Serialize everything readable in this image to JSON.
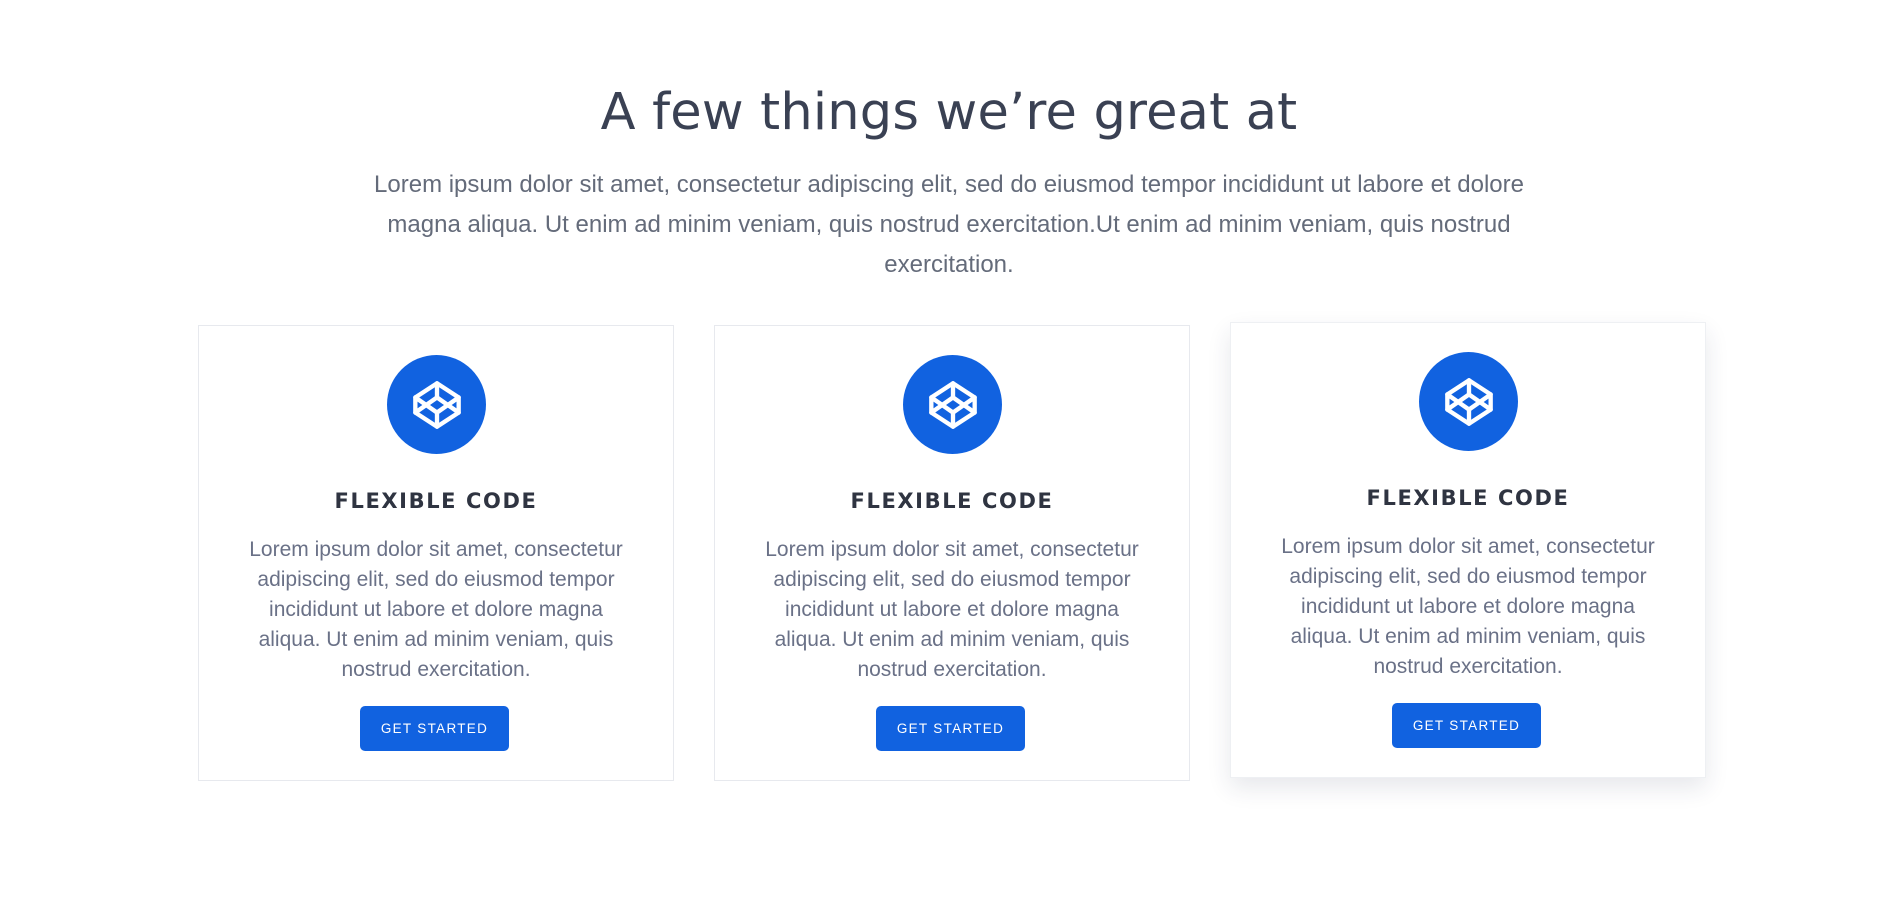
{
  "section": {
    "title": "A few things we’re great at",
    "description": "Lorem ipsum dolor sit amet, consectetur adipiscing elit, sed do eiusmod tempor incididunt ut labore et dolore magna aliqua. Ut enim ad minim veniam, quis nostrud exercitation.Ut enim ad minim veniam, quis nostrud exercitation."
  },
  "cards": [
    {
      "icon": "codepen-cube-icon",
      "title": "FLEXIBLE CODE",
      "text": "Lorem ipsum dolor sit amet, consectetur adipiscing elit, sed do eiusmod tempor incididunt ut labore et dolore magna aliqua. Ut enim ad minim veniam, quis nostrud exercitation.",
      "button_label": "GET STARTED"
    },
    {
      "icon": "codepen-cube-icon",
      "title": "FLEXIBLE CODE",
      "text": "Lorem ipsum dolor sit amet, consectetur adipiscing elit, sed do eiusmod tempor incididunt ut labore et dolore magna aliqua. Ut enim ad minim veniam, quis nostrud exercitation.",
      "button_label": "GET STARTED"
    },
    {
      "icon": "codepen-cube-icon",
      "title": "FLEXIBLE CODE",
      "text": "Lorem ipsum dolor sit amet, consectetur adipiscing elit, sed do eiusmod tempor incididunt ut labore et dolore magna aliqua. Ut enim ad minim veniam, quis nostrud exercitation.",
      "button_label": "GET STARTED"
    }
  ],
  "colors": {
    "accent": "#1162e0",
    "heading": "#3a4153",
    "body_text": "#6a7187"
  }
}
